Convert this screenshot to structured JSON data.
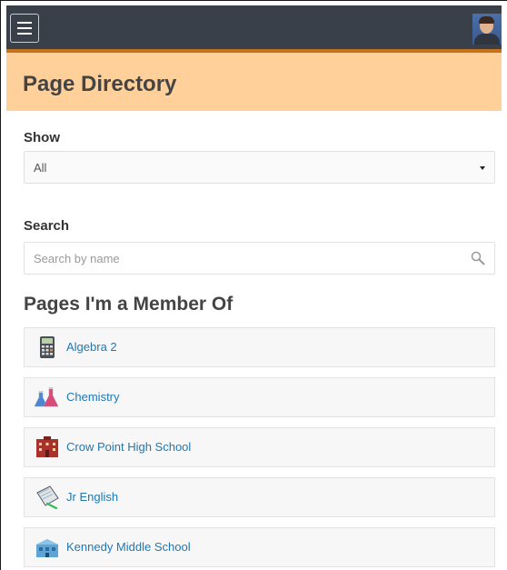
{
  "header": {
    "menu_icon": "hamburger-menu-icon",
    "avatar_icon": "user-avatar",
    "colors": {
      "bar": "#3a4049",
      "accent": "#c8721b"
    }
  },
  "page": {
    "title": "Page Directory",
    "title_band_color": "#ffd09a"
  },
  "filters": {
    "show_label": "Show",
    "show_value": "All",
    "search_label": "Search",
    "search_placeholder": "Search by name",
    "search_icon": "magnifier-icon"
  },
  "section": {
    "title": "Pages I'm a Member Of",
    "items": [
      {
        "label": "Algebra 2",
        "icon": "calculator-icon"
      },
      {
        "label": "Chemistry",
        "icon": "flasks-icon"
      },
      {
        "label": "Crow Point High School",
        "icon": "school-building-icon"
      },
      {
        "label": "Jr English",
        "icon": "notebook-pen-icon"
      },
      {
        "label": "Kennedy Middle School",
        "icon": "building-icon"
      }
    ],
    "link_color": "#1f78b4"
  }
}
